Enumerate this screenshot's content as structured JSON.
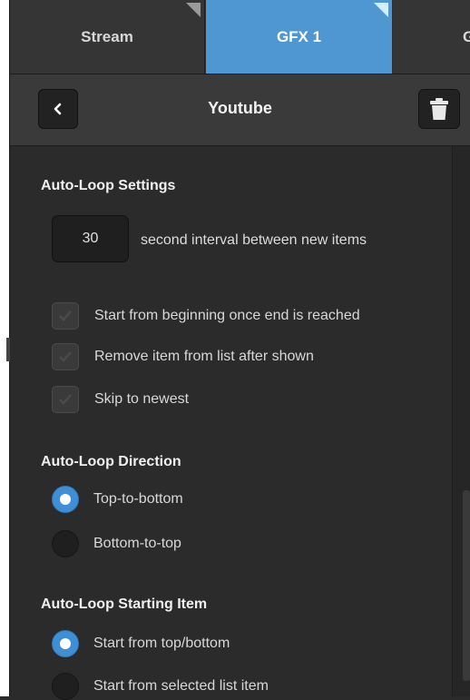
{
  "tabs": [
    {
      "label": "Stream",
      "active": false
    },
    {
      "label": "GFX 1",
      "active": true
    },
    {
      "label": "G",
      "active": false
    }
  ],
  "header": {
    "title": "Youtube",
    "back_icon": "chevron-left-icon",
    "delete_icon": "trash-icon"
  },
  "auto_loop_settings": {
    "title": "Auto-Loop Settings",
    "interval_value": "30",
    "interval_label": "second interval between new items",
    "options": [
      {
        "label": "Start from beginning once end is reached",
        "checked": false
      },
      {
        "label": "Remove item from list after shown",
        "checked": false
      },
      {
        "label": "Skip to newest",
        "checked": false
      }
    ]
  },
  "auto_loop_direction": {
    "title": "Auto-Loop Direction",
    "options": [
      {
        "label": "Top-to-bottom",
        "selected": true
      },
      {
        "label": "Bottom-to-top",
        "selected": false
      }
    ]
  },
  "auto_loop_starting_item": {
    "title": "Auto-Loop Starting Item",
    "options": [
      {
        "label": "Start from top/bottom",
        "selected": true
      },
      {
        "label": "Start from selected list item",
        "selected": false
      }
    ]
  },
  "colors": {
    "accent": "#4f97d2",
    "panel": "#2b2b2b"
  }
}
